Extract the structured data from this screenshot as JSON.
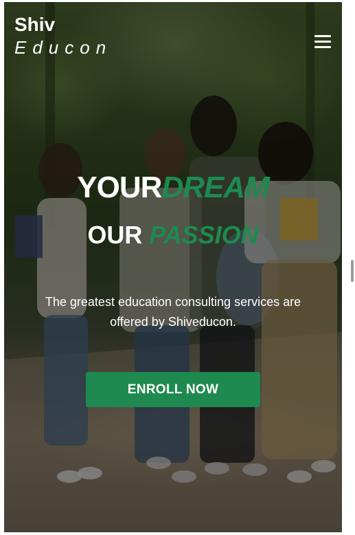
{
  "brand": {
    "name_line1": "Shiv",
    "name_line2": "Educon"
  },
  "nav": {
    "menu_icon": "hamburger-menu-icon"
  },
  "hero": {
    "background_image": "students-walking-photo",
    "headline_line1_plain": "YOUR",
    "headline_line1_accent": "DREAM",
    "headline_line2_plain": "OUR ",
    "headline_line2_accent": "PASSION",
    "subtitle": "The greatest education consulting services are offered by Shiveducon.",
    "cta_label": "ENROLL NOW"
  },
  "colors": {
    "accent_green": "#1e8a4f",
    "text_white": "#ffffff"
  }
}
